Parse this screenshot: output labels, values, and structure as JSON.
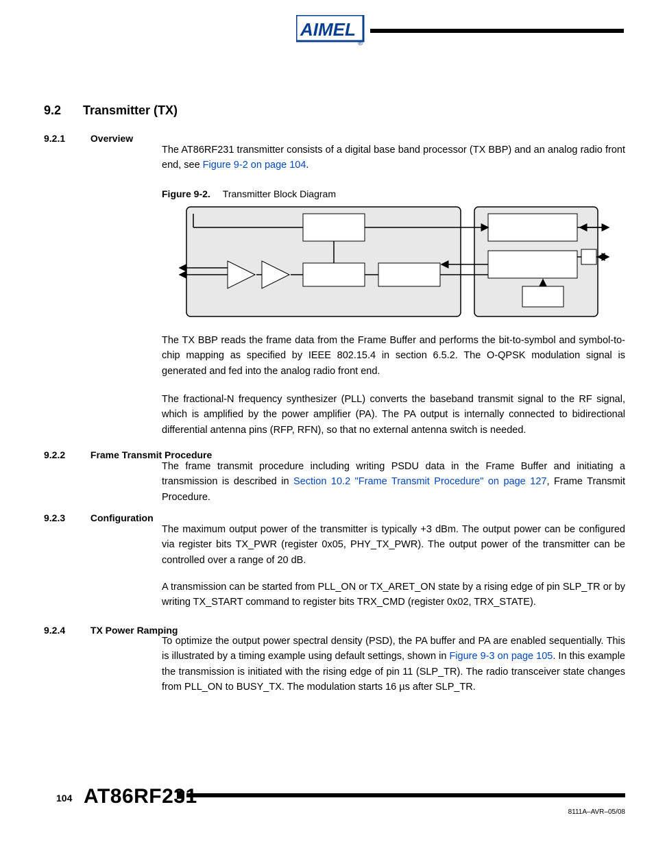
{
  "header": {
    "title_alt": "Atmel"
  },
  "section": {
    "number": "9.2",
    "title": "Transmitter (TX)"
  },
  "sub": {
    "s1": {
      "num": "9.2.1",
      "title": "Overview"
    },
    "s2": {
      "num": "9.2.2",
      "title": "Frame Transmit Procedure"
    },
    "s3": {
      "num": "9.2.3",
      "title": "Configuration"
    },
    "s4": {
      "num": "9.2.4",
      "title": "TX Power Ramping"
    }
  },
  "fig": {
    "label": "Figure 9-2.",
    "caption": "Transmitter Block Diagram"
  },
  "links": {
    "fig92": "Figure 9-2 on page 104",
    "sec102": "Section 10.2 \"Frame Transmit Procedure\" on page 127",
    "fig93": "Figure 9-3 on page 105"
  },
  "para": {
    "p1a": "The AT86RF231 transmitter consists of a digital base band processor (TX BBP) and an analog radio front end, see ",
    "p1b": ".",
    "p2": "The TX BBP reads the frame data from the Frame Buffer and performs the bit-to-symbol and symbol-to-chip mapping as specified by IEEE 802.15.4 in section 6.5.2. The O-QPSK modulation signal is generated and fed into the analog radio front end.",
    "p3": "The fractional-N frequency synthesizer (PLL) converts the baseband transmit signal to the RF signal, which is amplified by the power amplifier (PA). The PA output is internally connected to bidirectional differential antenna pins (RFP, RFN), so that no external antenna switch is needed.",
    "p4a": "The frame transmit procedure including writing PSDU data in the Frame Buffer and initiating a transmission is described in ",
    "p4b": ", Frame Transmit Procedure.",
    "p5": "The maximum output power of the transmitter is typically +3 dBm. The output power can be configured via register bits TX_PWR (register 0x05, PHY_TX_PWR). The output power of the transmitter can be controlled over a range of 20 dB.",
    "p6": "A transmission can be started from PLL_ON or TX_ARET_ON state by a rising edge of pin SLP_TR or by writing TX_START command to register bits TRX_CMD (register 0x02, TRX_STATE).",
    "p7a": "To optimize the output power spectral density (PSD), the PA buffer and PA are enabled sequentially. This is illustrated by a timing example using default settings, shown in ",
    "p7b": ". In this example the transmission is initiated with the rising edge of pin 11 (SLP_TR). The radio transceiver state changes from PLL_ON to BUSY_TX. The modulation starts 16 µs after SLP_TR."
  },
  "footer": {
    "page": "104",
    "doc_title": "AT86RF231",
    "doc_id": "8111A–AVR–05/08"
  }
}
